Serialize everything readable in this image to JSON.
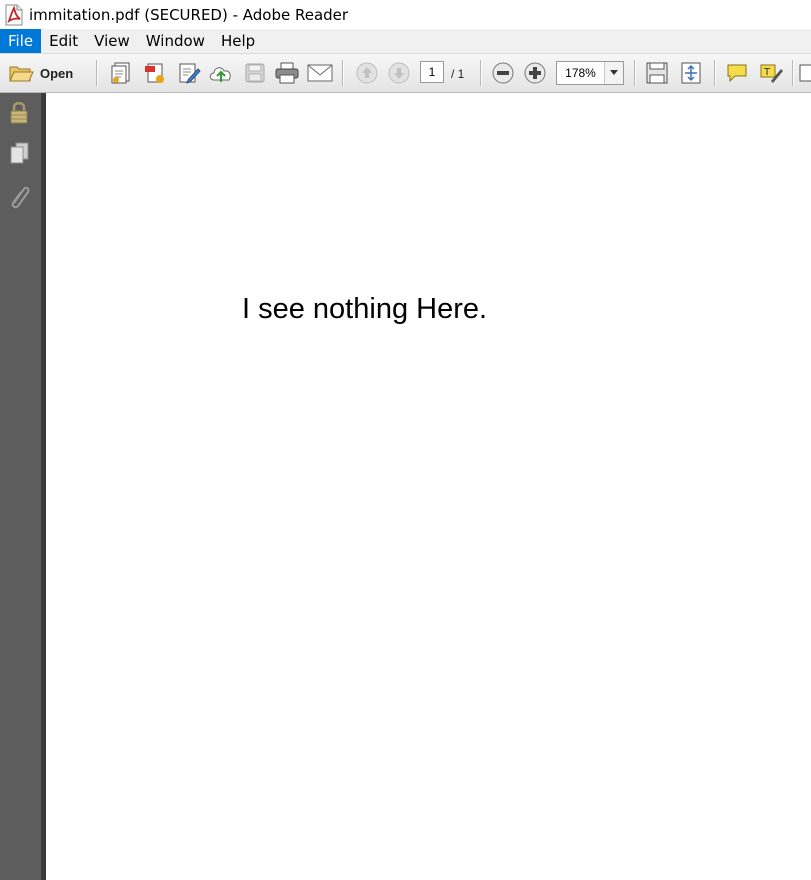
{
  "window": {
    "title": "immitation.pdf (SECURED) - Adobe Reader"
  },
  "menubar": {
    "items": [
      "File",
      "Edit",
      "View",
      "Window",
      "Help"
    ],
    "active": "File"
  },
  "toolbar": {
    "open_label": "Open",
    "page_current": "1",
    "page_total": "/ 1",
    "zoom": "178%"
  },
  "document": {
    "text": "I see nothing Here."
  },
  "colors": {
    "menu_active": "#0078d7",
    "left_nav": "#5d5d5d",
    "pdf_icon": "#c1272d"
  },
  "icons": [
    "pdf-app-icon",
    "open-folder-icon",
    "create-pdf-icon",
    "export-pdf-icon",
    "edit-pdf-icon",
    "upload-cloud-icon",
    "save-icon",
    "print-icon",
    "email-icon",
    "previous-page-icon",
    "next-page-icon",
    "zoom-out-icon",
    "zoom-in-icon",
    "fit-page-icon",
    "full-screen-icon",
    "comment-icon",
    "highlight-icon",
    "lock-icon",
    "pages-icon",
    "attachment-icon"
  ]
}
